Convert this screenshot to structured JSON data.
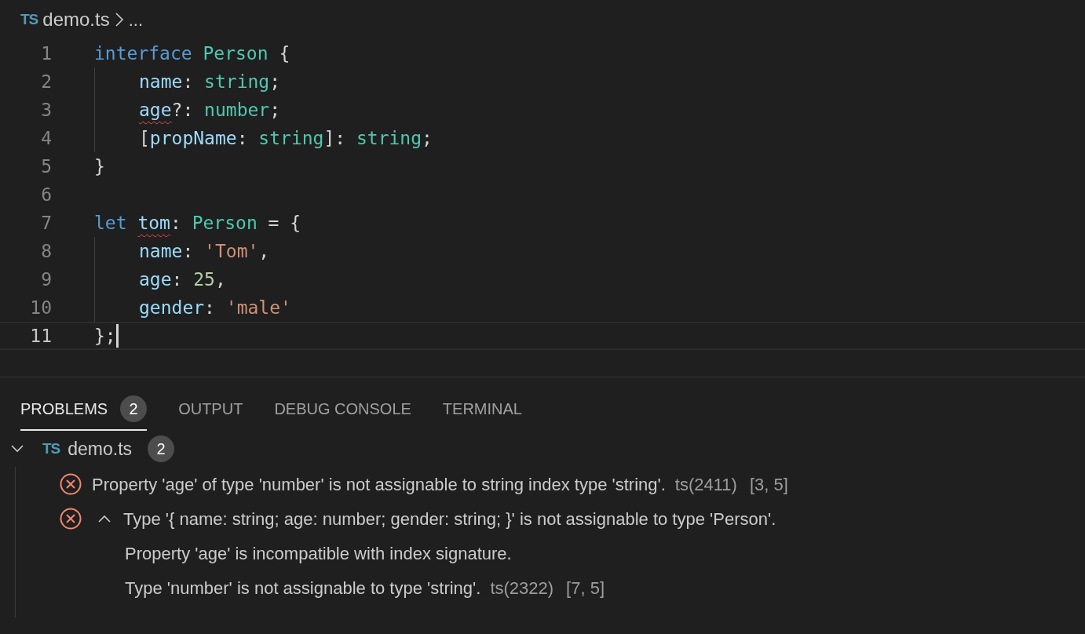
{
  "breadcrumb": {
    "file_icon": "TS",
    "file": "demo.ts",
    "rest": "..."
  },
  "editor": {
    "lines": [
      {
        "number": "1",
        "current": false,
        "indented": false,
        "tokens": [
          {
            "text": "interface ",
            "kind": "keyword"
          },
          {
            "text": "Person",
            "kind": "type"
          },
          {
            "text": " {",
            "kind": "punct"
          }
        ]
      },
      {
        "number": "2",
        "current": false,
        "indented": true,
        "tokens": [
          {
            "text": "name",
            "kind": "property"
          },
          {
            "text": ": ",
            "kind": "punct"
          },
          {
            "text": "string",
            "kind": "type"
          },
          {
            "text": ";",
            "kind": "punct"
          }
        ]
      },
      {
        "number": "3",
        "current": false,
        "indented": true,
        "tokens": [
          {
            "text": "age",
            "kind": "error-property"
          },
          {
            "text": "?: ",
            "kind": "punct"
          },
          {
            "text": "number",
            "kind": "type"
          },
          {
            "text": ";",
            "kind": "punct"
          }
        ]
      },
      {
        "number": "4",
        "current": false,
        "indented": true,
        "tokens": [
          {
            "text": "[",
            "kind": "punct"
          },
          {
            "text": "propName",
            "kind": "property"
          },
          {
            "text": ": ",
            "kind": "punct"
          },
          {
            "text": "string",
            "kind": "type"
          },
          {
            "text": "]: ",
            "kind": "punct"
          },
          {
            "text": "string",
            "kind": "type"
          },
          {
            "text": ";",
            "kind": "punct"
          }
        ]
      },
      {
        "number": "5",
        "current": false,
        "indented": false,
        "tokens": [
          {
            "text": "}",
            "kind": "punct"
          }
        ]
      },
      {
        "number": "6",
        "current": false,
        "indented": false
      },
      {
        "number": "7",
        "current": false,
        "indented": false,
        "tokens": [
          {
            "text": "let ",
            "kind": "keyword"
          },
          {
            "text": "tom",
            "kind": "error-property"
          },
          {
            "text": ": ",
            "kind": "punct"
          },
          {
            "text": "Person",
            "kind": "type"
          },
          {
            "text": " = {",
            "kind": "punct"
          }
        ]
      },
      {
        "number": "8",
        "current": false,
        "indented": true,
        "tokens": [
          {
            "text": "name",
            "kind": "property"
          },
          {
            "text": ": ",
            "kind": "punct"
          },
          {
            "text": "'Tom'",
            "kind": "string"
          },
          {
            "text": ",",
            "kind": "punct"
          }
        ]
      },
      {
        "number": "9",
        "current": false,
        "indented": true,
        "tokens": [
          {
            "text": "age",
            "kind": "property"
          },
          {
            "text": ": ",
            "kind": "punct"
          },
          {
            "text": "25",
            "kind": "number"
          },
          {
            "text": ",",
            "kind": "punct"
          }
        ]
      },
      {
        "number": "10",
        "current": false,
        "indented": true,
        "tokens": [
          {
            "text": "gender",
            "kind": "property"
          },
          {
            "text": ": ",
            "kind": "punct"
          },
          {
            "text": "'male'",
            "kind": "string"
          }
        ]
      },
      {
        "number": "11",
        "current": true,
        "indented": false,
        "tokens": [
          {
            "text": "};",
            "kind": "punct"
          }
        ]
      }
    ]
  },
  "panel": {
    "tabs": [
      {
        "label": "PROBLEMS",
        "badge": "2",
        "selected": true
      },
      {
        "label": "OUTPUT",
        "selected": false
      },
      {
        "label": "DEBUG CONSOLE",
        "selected": false
      },
      {
        "label": "TERMINAL",
        "selected": false
      }
    ],
    "file_group": {
      "expanded": true,
      "file_icon": "TS",
      "file": "demo.ts",
      "count": "2"
    },
    "problems": [
      {
        "kind": "single",
        "lines": [
          "Property 'age' of type 'number' is not assignable to string index type 'string'."
        ],
        "code": "ts(2411)",
        "location": "[3, 5]"
      },
      {
        "kind": "group",
        "expanded": true,
        "lines": [
          "Type '{ name: string; age: number; gender: string; }' is not assignable to type 'Person'.",
          "Property 'age' is incompatible with index signature.",
          "Type 'number' is not assignable to type 'string'."
        ],
        "code": "ts(2322)",
        "location": "[7, 5]"
      }
    ]
  }
}
